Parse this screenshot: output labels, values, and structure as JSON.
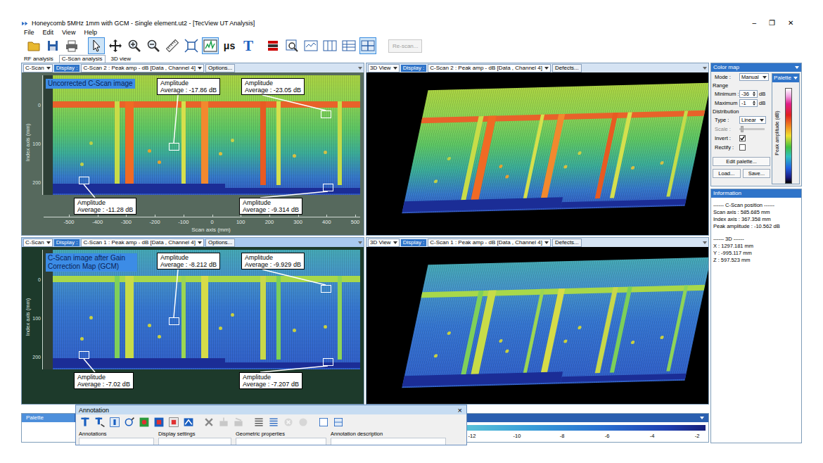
{
  "window": {
    "title": "Honeycomb 5MHz 1mm with GCM - Single element.ut2 - [TecView UT Analysis]",
    "controls": [
      "–",
      "❐",
      "✕"
    ]
  },
  "menu": [
    "File",
    "Edit",
    "View",
    "Help"
  ],
  "toolbar": {
    "tools": [
      {
        "selected": false
      },
      {
        "selected": false
      },
      {
        "selected": false
      },
      {
        "selected": true
      },
      {
        "selected": false
      },
      {
        "selected": false
      },
      {
        "selected": false
      },
      {
        "selected": false
      },
      {
        "selected": false
      },
      {
        "selected": true
      },
      {
        "label": "μs",
        "selected": false
      },
      {
        "label": "T",
        "selected": false
      },
      {
        "selected": false
      },
      {
        "selected": false
      },
      {
        "selected": false
      },
      {
        "selected": false
      },
      {
        "selected": false
      },
      {
        "selected": true
      }
    ],
    "rescan": {
      "label": "Re-scan...",
      "disabled": true
    }
  },
  "tabs": [
    {
      "label": "RF analysis",
      "selected": false
    },
    {
      "label": "C-Scan analysis",
      "selected": true
    },
    {
      "label": "3D view",
      "selected": false
    }
  ],
  "cscan_panels": [
    {
      "kind": "uncorrected",
      "view": "C-Scan",
      "display_label": "Display :",
      "display": "C-Scan 2 : Peak amp - dB [Data , Channel 4]",
      "options": "Options...",
      "caption": "Uncorrected C-Scan image",
      "active": false,
      "y_axis_title": "Index axis (mm)",
      "y_ticks": [
        "0",
        "100",
        "200"
      ],
      "x_axis_title": "Scan axis (mm)",
      "x_ticks": [
        "-500",
        "-400",
        "-300",
        "-200",
        "-100",
        "0",
        "100",
        "200",
        "300",
        "400",
        "500"
      ],
      "annotations": [
        {
          "title": "Amplitude",
          "value": "Average : -17.86 dB"
        },
        {
          "title": "Amplitude",
          "value": "Average : -23.05 dB"
        },
        {
          "title": "Amplitude",
          "value": "Average : -11.28 dB"
        },
        {
          "title": "Amplitude",
          "value": "Average : -9.314 dB"
        }
      ]
    },
    {
      "kind": "corrected",
      "view": "C-Scan",
      "display_label": "Display :",
      "display": "C-Scan 1 : Peak amp - dB [Data , Channel 4]",
      "options": "Options...",
      "caption": "C-Scan image after Gain Correction Map (GCM)",
      "active": true,
      "y_axis_title": "Index axis (mm)",
      "y_ticks": [
        "0",
        "100",
        "200"
      ],
      "x_axis_title": "",
      "x_ticks": [],
      "annotations": [
        {
          "title": "Amplitude",
          "value": "Average : -8.212 dB"
        },
        {
          "title": "Amplitude",
          "value": "Average : -9.929 dB"
        },
        {
          "title": "Amplitude",
          "value": "Average : -7.02 dB"
        },
        {
          "title": "Amplitude",
          "value": "Average : -7.207 dB"
        }
      ]
    }
  ],
  "view3d_panels": [
    {
      "kind": "uncorrected",
      "view": "3D View",
      "display_label": "Display :",
      "display": "C-Scan 2 : Peak amp - dB [Data , Channel 4]",
      "defects": "Defects..."
    },
    {
      "kind": "corrected",
      "view": "3D View",
      "display_label": "Display :",
      "display": "C-Scan 1 : Peak amp - dB [Data , Channel 4]",
      "defects": "Defects..."
    }
  ],
  "color_map": {
    "title": "Color map",
    "mode_label": "Mode :",
    "mode": "Manual",
    "range_label": "Range",
    "min_label": "Minimum :",
    "min": "-36",
    "min_unit": "dB",
    "max_label": "Maximum :",
    "max": "-1",
    "max_unit": "dB",
    "distribution_label": "Distribution",
    "type_label": "Type :",
    "type": "Linear",
    "scale_label": "Scale :",
    "scale_disabled": true,
    "invert_label": "Invert :",
    "invert": true,
    "rectify_label": "Rectify :",
    "rectify": false,
    "buttons": [
      "Edit palette...",
      "Load...",
      "Save..."
    ],
    "palette_tab": "Palette",
    "palette_axis": "Peak amplitude (dB)"
  },
  "information": {
    "title": "Information",
    "cscan_position": [
      "------ C-Scan position ------",
      "Scan axis : 585.685 mm",
      "Index axis : 367.358 mm",
      "Peak amplitude : -10.562 dB"
    ],
    "position_3d": [
      "------ 3D ------",
      "X : 1297.181 mm",
      "Y : -995.117 mm",
      "Z : 597.523 mm"
    ]
  },
  "palette_strip": {
    "title": "Palette",
    "ticks": [
      "-12",
      "-10",
      "-8",
      "-6",
      "-4",
      "-2"
    ]
  },
  "annotation_dialog": {
    "title": "Annotation",
    "close": "×",
    "tools": [
      {
        "disabled": false
      },
      {
        "disabled": false
      },
      {
        "disabled": false
      },
      {
        "disabled": false
      },
      {
        "disabled": false
      },
      {
        "disabled": false
      },
      {
        "disabled": false
      },
      {
        "disabled": false
      },
      {
        "disabled": false
      },
      {
        "disabled": true
      },
      {
        "disabled": true
      },
      {
        "disabled": false
      },
      {
        "disabled": false
      },
      {
        "disabled": true
      },
      {
        "disabled": true
      },
      {
        "disabled": false
      },
      {
        "disabled": false
      }
    ],
    "sections": [
      "Annotations",
      "Display settings",
      "Geometric properties",
      "Annotation description"
    ]
  }
}
